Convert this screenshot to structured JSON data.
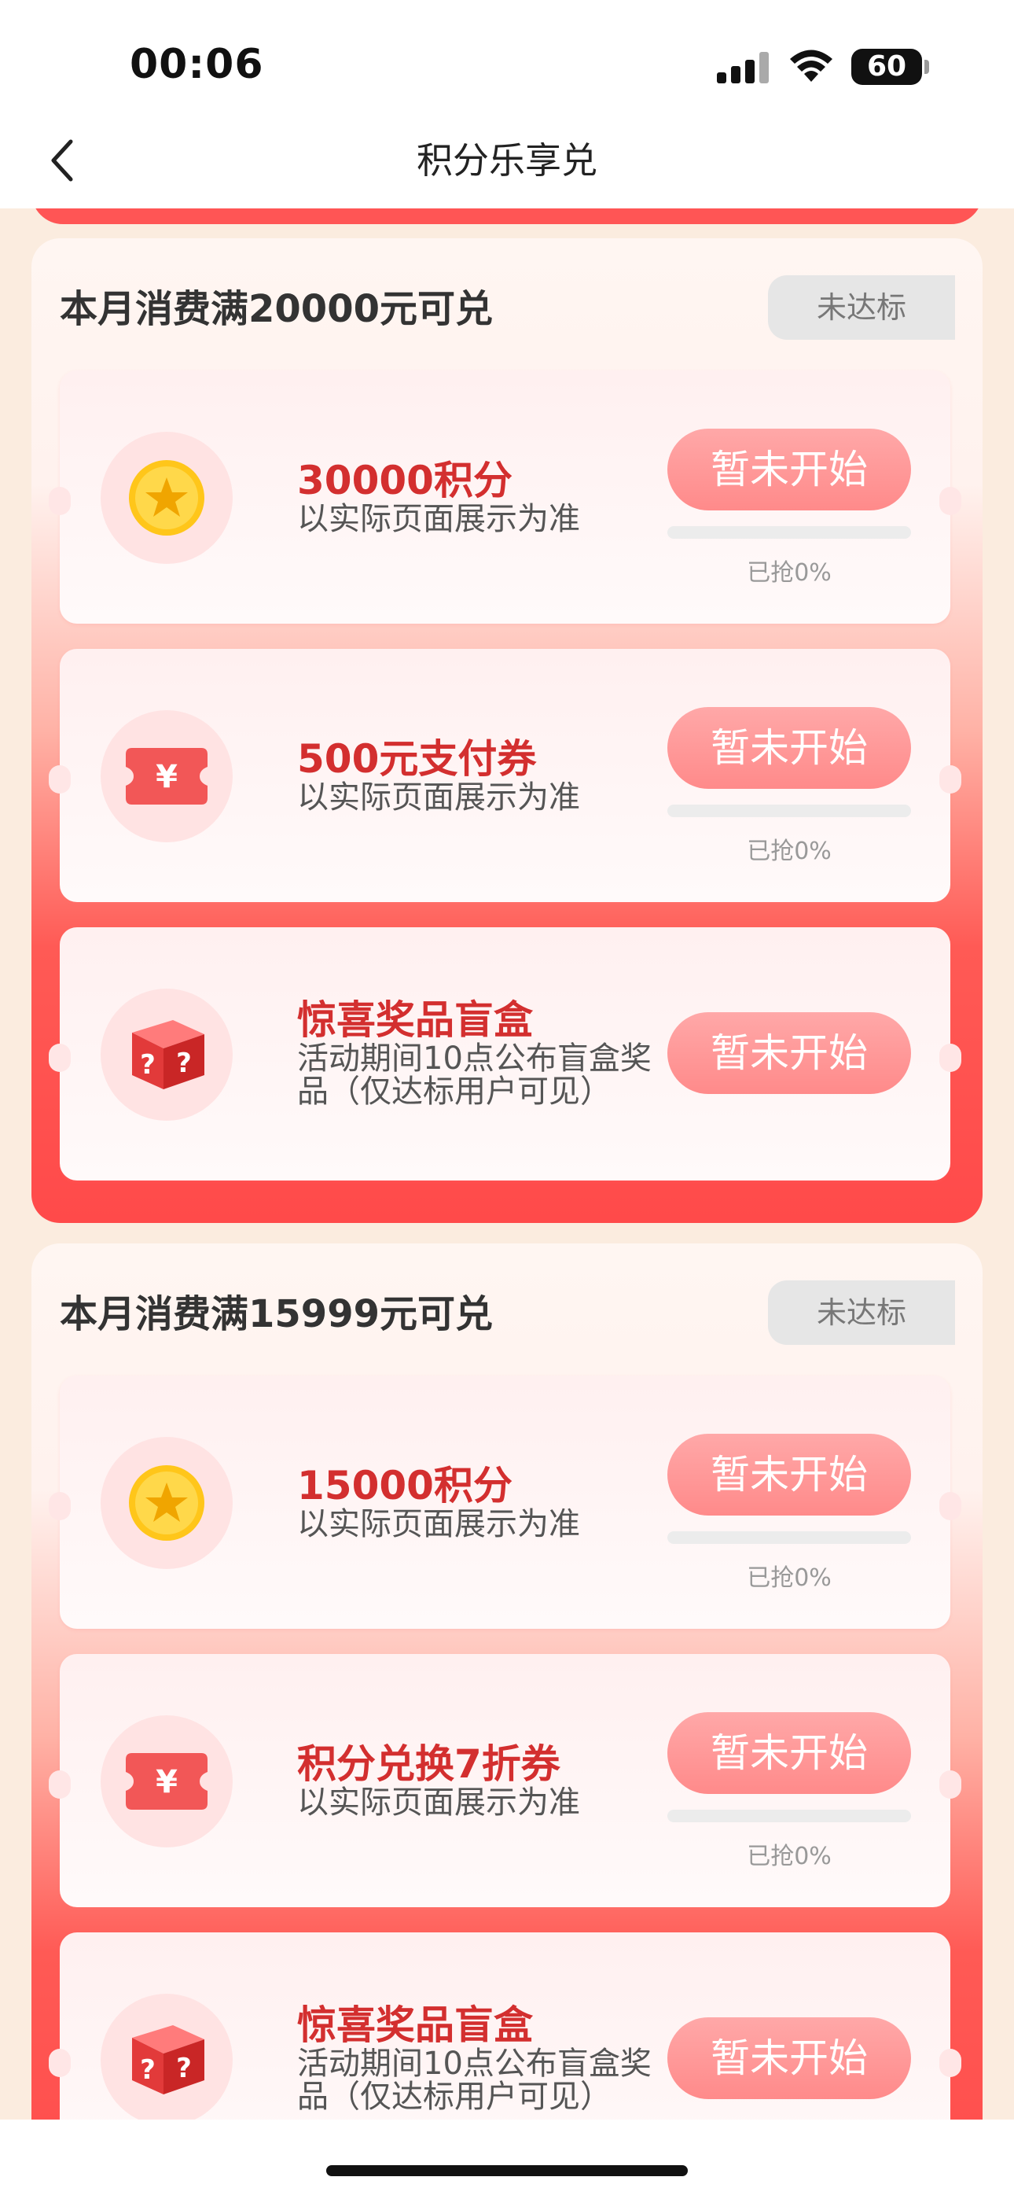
{
  "status_bar": {
    "time": "00:06",
    "battery": "60"
  },
  "nav": {
    "title": "积分乐享兑"
  },
  "sections": [
    {
      "title": "本月消费满20000元可兑",
      "status": "未达标",
      "items": [
        {
          "title": "30000积分",
          "subtitle": "以实际页面展示为准",
          "button": "暂未开始",
          "progress_text": "已抢0%",
          "progress": 0,
          "icon": "gold-coin-icon"
        },
        {
          "title": "500元支付券",
          "subtitle": "以实际页面展示为准",
          "button": "暂未开始",
          "progress_text": "已抢0%",
          "progress": 0,
          "icon": "yuan-coupon-icon"
        },
        {
          "title": "惊喜奖品盲盒",
          "subtitle": "活动期间10点公布盲盒奖品（仅达标用户可见）",
          "button": "暂未开始",
          "icon": "mystery-box-icon"
        }
      ]
    },
    {
      "title": "本月消费满15999元可兑",
      "status": "未达标",
      "items": [
        {
          "title": "15000积分",
          "subtitle": "以实际页面展示为准",
          "button": "暂未开始",
          "progress_text": "已抢0%",
          "progress": 0,
          "icon": "gold-coin-icon"
        },
        {
          "title": "积分兑换7折券",
          "subtitle": "以实际页面展示为准",
          "button": "暂未开始",
          "progress_text": "已抢0%",
          "progress": 0,
          "icon": "yuan-coupon-icon"
        },
        {
          "title": "惊喜奖品盲盒",
          "subtitle": "活动期间10点公布盲盒奖品（仅达标用户可见）",
          "button": "暂未开始",
          "icon": "mystery-box-icon"
        }
      ]
    }
  ],
  "colors": {
    "accent": "#d32f2f",
    "button": "#ff9a9a",
    "section_bottom": "#ff4a4a",
    "page_bg": "#fbecdf"
  }
}
